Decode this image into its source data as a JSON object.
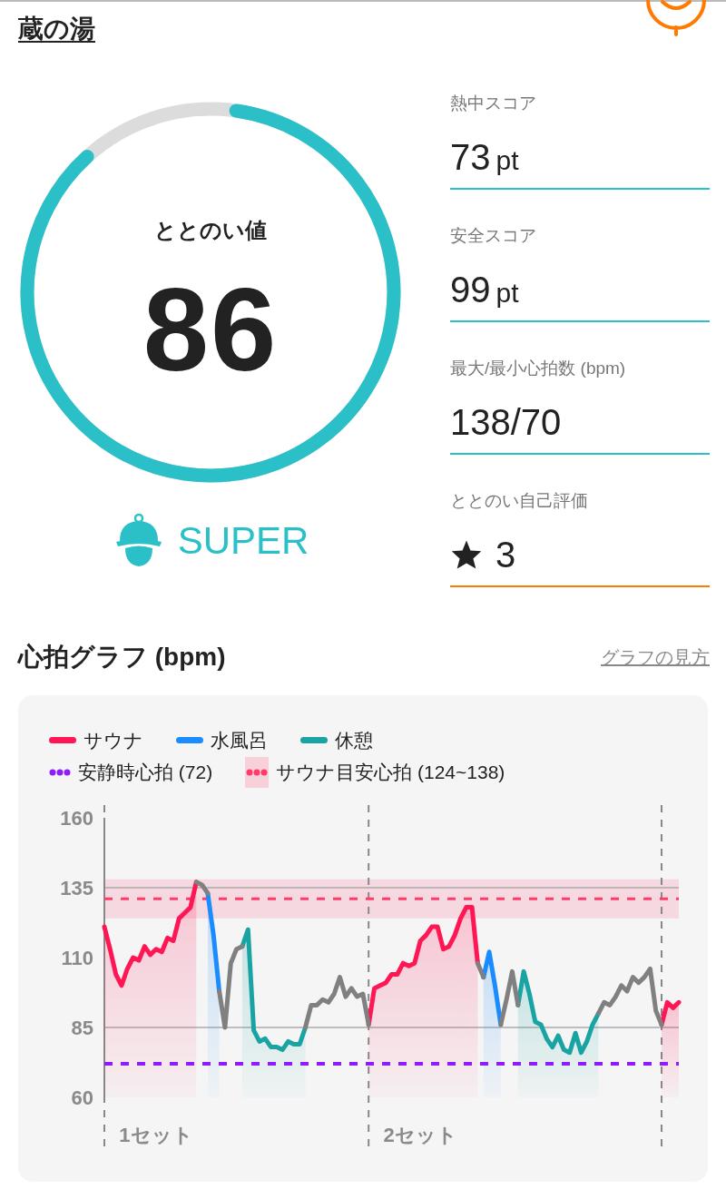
{
  "header": {
    "title": "蔵の湯"
  },
  "gauge": {
    "label": "ととのい値",
    "score": "86",
    "rank": "SUPER"
  },
  "stats": [
    {
      "kind": "score",
      "label": "熱中スコア",
      "value": "73",
      "unit": "pt"
    },
    {
      "kind": "score",
      "label": "安全スコア",
      "value": "99",
      "unit": "pt"
    },
    {
      "kind": "score",
      "label": "最大/最小心拍数 (bpm)",
      "value": "138/70"
    },
    {
      "kind": "rating",
      "label": "ととのい自己評価",
      "value": "3"
    }
  ],
  "heart_section": {
    "title": "心拍グラフ (bpm)",
    "help_link": "グラフの見方",
    "chart_data": {
      "type": "line",
      "legend": "top",
      "categories": [
        null,
        null,
        null,
        null,
        null,
        null,
        null,
        null,
        null,
        "1セット",
        null,
        null,
        null,
        null,
        null,
        null,
        null,
        null,
        null,
        null,
        null,
        null,
        null,
        null,
        null,
        null,
        null,
        null,
        null,
        null,
        null,
        null,
        null,
        null,
        null,
        null,
        null,
        null,
        null,
        null,
        null,
        null,
        null,
        null,
        null,
        null,
        null,
        null,
        null,
        null,
        null,
        null,
        null,
        null,
        null,
        "2セット",
        null,
        null,
        null,
        null,
        null,
        null,
        null,
        null,
        null,
        null,
        null,
        null,
        null,
        null,
        null,
        null,
        null,
        null,
        null,
        null,
        null,
        null,
        null,
        null,
        null,
        null,
        null,
        null,
        null,
        null,
        null,
        null,
        null,
        null,
        null,
        null,
        null,
        null,
        null,
        null,
        null,
        null,
        null,
        null,
        null
      ],
      "ylim": [
        60,
        160
      ],
      "yticks": [
        60,
        85,
        110,
        135,
        160
      ],
      "series": [
        {
          "name": "サウナ",
          "color": "#ff1654",
          "values": [
            121,
            113,
            104,
            100,
            106,
            110,
            109,
            114,
            111,
            113,
            112,
            117,
            116,
            124,
            126,
            128,
            137,
            null,
            null,
            null,
            null,
            null,
            null,
            null,
            null,
            null,
            null,
            null,
            null,
            null,
            null,
            null,
            null,
            null,
            null,
            null,
            null,
            null,
            null,
            null,
            null,
            null,
            null,
            null,
            null,
            null,
            86,
            99,
            100,
            101,
            104,
            104,
            108,
            107,
            108,
            116,
            118,
            121,
            121,
            113,
            114,
            118,
            124,
            128,
            128,
            108,
            null,
            null,
            null,
            null,
            null,
            null,
            null,
            null,
            null,
            null,
            null,
            null,
            null,
            null,
            null,
            null,
            null,
            null,
            null,
            null,
            null,
            null,
            null,
            null,
            null,
            null,
            null,
            null,
            null,
            null,
            null,
            86,
            94,
            92,
            94
          ]
        },
        {
          "name": "水風呂",
          "color": "#1a8cff",
          "values": [
            null,
            null,
            null,
            null,
            null,
            null,
            null,
            null,
            null,
            null,
            null,
            null,
            null,
            null,
            null,
            null,
            null,
            null,
            133,
            118,
            98,
            null,
            null,
            null,
            null,
            null,
            null,
            null,
            null,
            null,
            null,
            null,
            null,
            null,
            null,
            null,
            null,
            null,
            null,
            null,
            null,
            null,
            null,
            null,
            null,
            null,
            null,
            null,
            null,
            null,
            null,
            null,
            null,
            null,
            null,
            null,
            null,
            null,
            null,
            null,
            null,
            null,
            null,
            null,
            null,
            null,
            103,
            112,
            100,
            86,
            null,
            null,
            null,
            null,
            null,
            null,
            null,
            null,
            null,
            null,
            null,
            null,
            null,
            null,
            null,
            null,
            null,
            null,
            null,
            null,
            null,
            null,
            null,
            null,
            null,
            null,
            null,
            null,
            null,
            null,
            null
          ]
        },
        {
          "name": "休憩",
          "color": "#1aa3a3",
          "values": [
            null,
            null,
            null,
            null,
            null,
            null,
            null,
            null,
            null,
            null,
            null,
            null,
            null,
            null,
            null,
            null,
            null,
            null,
            null,
            null,
            null,
            null,
            null,
            null,
            114,
            120,
            84,
            80,
            81,
            78,
            78,
            77,
            80,
            79,
            79,
            85,
            null,
            null,
            null,
            null,
            null,
            null,
            null,
            null,
            null,
            null,
            null,
            null,
            null,
            null,
            null,
            null,
            null,
            null,
            null,
            null,
            null,
            null,
            null,
            null,
            null,
            null,
            null,
            null,
            null,
            null,
            null,
            null,
            null,
            null,
            null,
            null,
            93,
            105,
            97,
            87,
            86,
            81,
            78,
            82,
            77,
            76,
            83,
            76,
            80,
            86,
            90,
            null,
            null,
            null,
            null,
            null,
            null,
            null,
            null,
            null,
            null,
            null,
            null,
            null,
            null
          ]
        },
        {
          "color": "#808080",
          "values": [
            null,
            null,
            null,
            null,
            null,
            null,
            null,
            null,
            null,
            null,
            null,
            null,
            null,
            null,
            null,
            null,
            137,
            136,
            133,
            null,
            98,
            85,
            108,
            113,
            114,
            null,
            null,
            null,
            null,
            null,
            null,
            null,
            null,
            null,
            null,
            85,
            93,
            93,
            95,
            94,
            97,
            103,
            96,
            99,
            96,
            97,
            86,
            null,
            null,
            null,
            null,
            null,
            null,
            null,
            null,
            null,
            null,
            null,
            null,
            null,
            null,
            null,
            null,
            null,
            null,
            108,
            103,
            null,
            null,
            86,
            95,
            105,
            93,
            null,
            null,
            null,
            null,
            null,
            null,
            null,
            null,
            null,
            null,
            null,
            null,
            null,
            90,
            94,
            93,
            96,
            100,
            98,
            103,
            101,
            103,
            106,
            91,
            86,
            null,
            null,
            null
          ]
        }
      ],
      "ref_lines": [
        {
          "axis": "y",
          "value": 72,
          "label": "安静時心拍 (72)",
          "color": "#8f1cff"
        },
        {
          "axis": "y",
          "value": 131,
          "color": "#ff3b6b"
        }
      ],
      "bands": [
        {
          "axis": "y",
          "from": 124,
          "to": 138,
          "label": "サウナ目安心拍 (124~138)",
          "color": "#ff3b6b"
        }
      ]
    }
  }
}
